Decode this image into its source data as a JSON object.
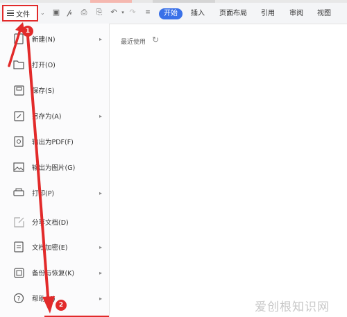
{
  "toolbar": {
    "file_menu_label": "文件",
    "start_tab": "开始",
    "tabs": [
      "插入",
      "页面布局",
      "引用",
      "审阅",
      "视图"
    ]
  },
  "file_menu": {
    "items": [
      {
        "label": "新建(N)",
        "icon": "new-icon",
        "has_submenu": true
      },
      {
        "label": "打开(O)",
        "icon": "folder-icon",
        "has_submenu": false
      },
      {
        "label": "保存(S)",
        "icon": "save-icon",
        "has_submenu": false
      },
      {
        "label": "另存为(A)",
        "icon": "save-as-icon",
        "has_submenu": true
      },
      {
        "label": "输出为PDF(F)",
        "icon": "pdf-icon",
        "has_submenu": false
      },
      {
        "label": "输出为图片(G)",
        "icon": "image-icon",
        "has_submenu": false
      },
      {
        "label": "打印(P)",
        "icon": "print-icon",
        "has_submenu": true
      },
      {
        "label": "分享文档(D)",
        "icon": "share-icon",
        "has_submenu": false
      },
      {
        "label": "文档加密(E)",
        "icon": "encrypt-icon",
        "has_submenu": true
      },
      {
        "label": "备份与恢复(K)",
        "icon": "backup-icon",
        "has_submenu": true
      },
      {
        "label": "帮助(H)",
        "icon": "help-icon",
        "has_submenu": true
      }
    ]
  },
  "recent": {
    "label": "最近使用"
  },
  "annotations": {
    "badge1": "1",
    "badge2": "2"
  },
  "watermark": "爱创根知识网",
  "colors": {
    "accent": "#3a71e8",
    "annotation": "#e22a2a"
  }
}
